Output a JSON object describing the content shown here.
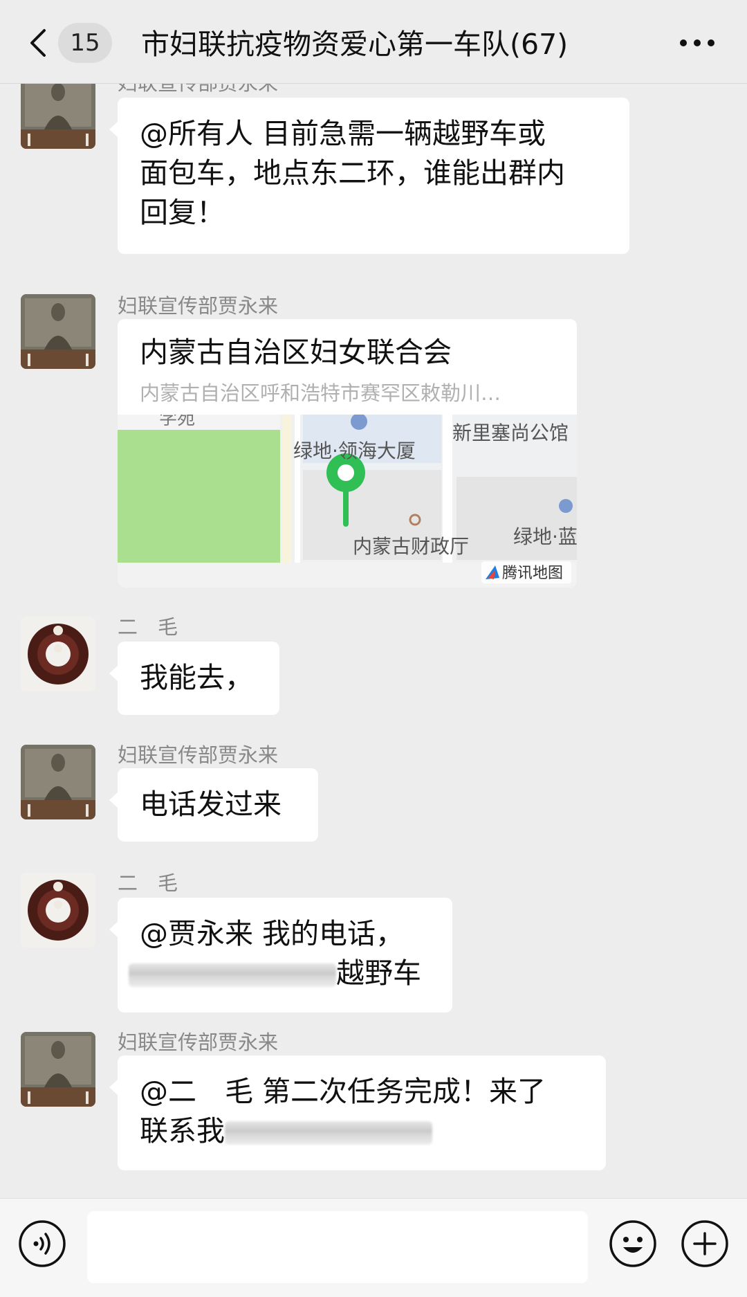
{
  "header": {
    "back_label": "返回",
    "unread_count": "15",
    "title": "市妇联抗疫物资爱心第一车队(67)"
  },
  "messages": [
    {
      "sender": "妇联宣传部贾永来",
      "avatar": "statue-avatar",
      "type": "text",
      "lines": [
        "@所有人 目前急需一辆越野车或",
        "面包车，地点东二环，谁能出群内",
        "回复！"
      ]
    },
    {
      "sender": "妇联宣传部贾永来",
      "avatar": "statue-avatar",
      "type": "location",
      "location": {
        "name": "内蒙古自治区妇女联合会",
        "address": "内蒙古自治区呼和浩特市赛罕区敕勒川…",
        "map_labels": {
          "building_1": "绿地·领海大厦",
          "building_2": "新里塞尚公馆",
          "building_3": "内蒙古财政厅",
          "building_4": "绿地·蓝",
          "road_top": "学苑",
          "provider": "腾讯地图"
        }
      }
    },
    {
      "sender": "二　毛",
      "avatar": "beads-avatar",
      "type": "text",
      "lines": [
        "我能去，"
      ]
    },
    {
      "sender": "妇联宣传部贾永来",
      "avatar": "statue-avatar",
      "type": "text",
      "lines": [
        "电话发过来"
      ]
    },
    {
      "sender": "二　毛",
      "avatar": "beads-avatar",
      "type": "text",
      "lines": [
        "@贾永来 我的电话，",
        "越野车"
      ]
    },
    {
      "sender": "妇联宣传部贾永来",
      "avatar": "statue-avatar",
      "type": "text",
      "lines": [
        "@二　毛 第二次任务完成！来了",
        "联系我"
      ]
    }
  ],
  "input_bar": {
    "voice_icon": "voice-icon",
    "emoji_icon": "emoji-icon",
    "add_icon": "plus-icon",
    "text_value": ""
  },
  "colors": {
    "background": "#ededed",
    "bubble": "#ffffff",
    "sender_name": "#888888",
    "map_pin": "#2fbf55"
  }
}
